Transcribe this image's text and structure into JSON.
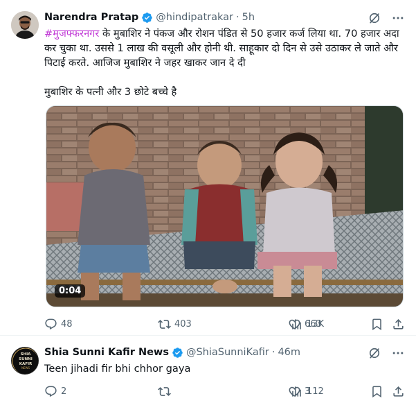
{
  "colors": {
    "verified_badge": "#1d9bf0",
    "hashtag": "#c13ad6",
    "secondary_text": "#536471"
  },
  "tweets": [
    {
      "display_name": "Narendra Pratap",
      "handle": "@hindipatrakar",
      "separator": "·",
      "time": "5h",
      "hashtag": "#मुजफ्फरनगर",
      "text_rest": " के मुबाशिर ने पंकज और रोशन पंडित से 50 हजार कर्ज लिया था. 70 हजार अदा कर चुका था. उससे 1 लाख की वसूली और होनी थी. साहूकार दो दिन से उसे उठाकर ले जाते और पिटाई करते. आजिज मुबाशिर ने जहर खाकर जान दे दी",
      "text_para2": "मुबाशिर के पत्नी और 3 छोटे बच्चे है",
      "video_time": "0:04",
      "stats": {
        "replies": "48",
        "reposts": "403",
        "likes": "663",
        "views": "13K"
      },
      "icons": [
        "grok-icon",
        "more-icon",
        "reply-icon",
        "repost-icon",
        "like-icon",
        "views-icon",
        "bookmark-icon",
        "share-icon"
      ]
    },
    {
      "display_name": "Shia Sunni Kafir News",
      "handle": "@ShiaSunniKafir",
      "separator": "·",
      "time": "46m",
      "text": "Teen jihadi fir bhi chhor gaya",
      "avatar_text": [
        "SHIA",
        "SUNNI",
        "KAFIR",
        "NEWS"
      ],
      "stats": {
        "replies": "2",
        "reposts": "",
        "likes": "3",
        "views": "112"
      }
    }
  ]
}
